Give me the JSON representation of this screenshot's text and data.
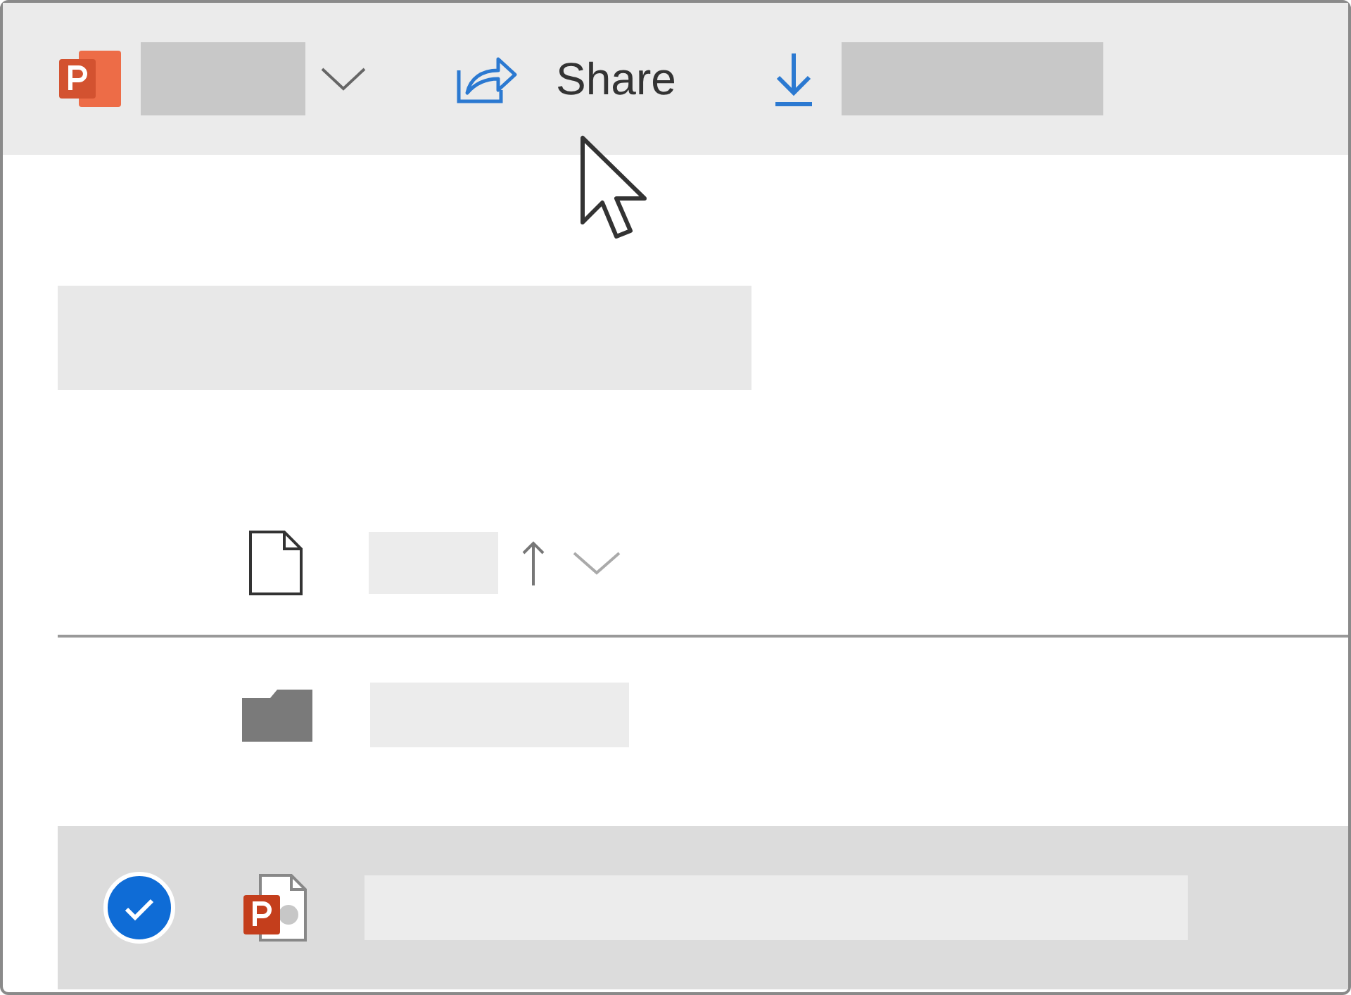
{
  "toolbar": {
    "share_button": {
      "label": "Share"
    }
  },
  "file_list": {
    "rows": [
      {
        "kind": "folder",
        "selected": false
      },
      {
        "kind": "presentation",
        "selected": true
      }
    ]
  }
}
